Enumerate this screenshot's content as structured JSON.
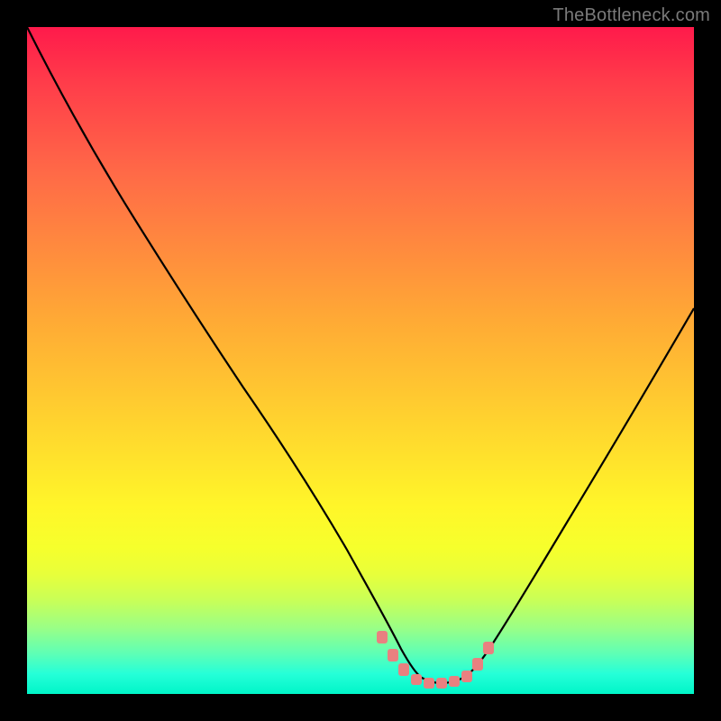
{
  "attribution": "TheBottleneck.com",
  "colors": {
    "background": "#000000",
    "gradient_top": "#ff1a4b",
    "gradient_bottom": "#00f5c8",
    "curve": "#000000",
    "marker": "#e98080"
  },
  "chart_data": {
    "type": "line",
    "title": "",
    "xlabel": "",
    "ylabel": "",
    "xlim": [
      0,
      100
    ],
    "ylim": [
      0,
      100
    ],
    "grid": false,
    "legend": false,
    "series": [
      {
        "name": "curve",
        "x": [
          0,
          5,
          10,
          15,
          20,
          25,
          30,
          35,
          40,
          45,
          50,
          53,
          56,
          58,
          60,
          62,
          64,
          66,
          68,
          70,
          75,
          80,
          85,
          90,
          95,
          100
        ],
        "y": [
          100,
          90,
          80,
          71,
          62,
          54,
          46,
          38,
          30,
          23,
          16,
          11,
          7,
          5,
          3.5,
          3,
          3,
          3.5,
          5,
          7.5,
          14,
          22,
          31,
          40,
          49,
          58
        ]
      }
    ],
    "markers": {
      "x": [
        53,
        56,
        58,
        60,
        62,
        64,
        66,
        68
      ],
      "y": [
        11,
        7,
        5,
        3.5,
        3,
        3,
        3.5,
        5
      ]
    }
  }
}
